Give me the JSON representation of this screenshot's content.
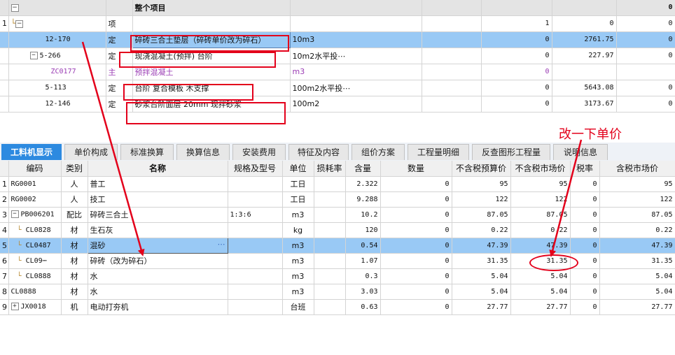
{
  "top_table": {
    "rows": [
      {
        "idx": "",
        "code": "",
        "type": "",
        "name": "整个项目",
        "unit": "",
        "c1": "",
        "c2": "",
        "c3": "0"
      },
      {
        "idx": "1",
        "code": "",
        "type": "项",
        "name": "",
        "unit": "",
        "c1": "1",
        "c2": "0",
        "c3": "0"
      },
      {
        "idx": "",
        "code": "12-170",
        "type": "定",
        "name": "碎砖三合土垫层（碎砖单价改为碎石）",
        "unit": "10m3",
        "c1": "0",
        "c2": "2761.75",
        "c3": "0"
      },
      {
        "idx": "",
        "code": "5-266",
        "type": "定",
        "name": "现浇混凝土(预拌) 台阶",
        "unit": "10m2水平投⋯",
        "c1": "0",
        "c2": "227.97",
        "c3": "0"
      },
      {
        "idx": "",
        "code": "ZC0177",
        "type": "主",
        "name": "预拌混凝土",
        "unit": "m3",
        "c1": "0",
        "c2": "",
        "c3": ""
      },
      {
        "idx": "",
        "code": "5-113",
        "type": "定",
        "name": "台阶 复合模板 木支撑",
        "unit": "100m2水平投⋯",
        "c1": "0",
        "c2": "5643.08",
        "c3": "0"
      },
      {
        "idx": "",
        "code": "12-146",
        "type": "定",
        "name": "砂浆台阶面层 20mm 现拌砂浆",
        "unit": "100m2",
        "c1": "0",
        "c2": "3173.67",
        "c3": "0"
      }
    ]
  },
  "tabs": [
    "工料机显示",
    "单价构成",
    "标准换算",
    "换算信息",
    "安装费用",
    "特征及内容",
    "组价方案",
    "工程量明细",
    "反查图形工程量",
    "说明信息"
  ],
  "annotation": "改一下单价",
  "bottom_table": {
    "headers": [
      "",
      "编码",
      "类别",
      "名称",
      "规格及型号",
      "单位",
      "损耗率",
      "含量",
      "数量",
      "不含税预算价",
      "不含税市场价",
      "税率",
      "含税市场价"
    ],
    "rows": [
      {
        "idx": "1",
        "code": "RG0001",
        "cat": "人",
        "name": "普工",
        "spec": "",
        "unit": "工日",
        "loss": "",
        "qty": "2.322",
        "amount": "0",
        "budget": "95",
        "market": "95",
        "tax": "0",
        "taxed": "95"
      },
      {
        "idx": "2",
        "code": "RG0002",
        "cat": "人",
        "name": "技工",
        "spec": "",
        "unit": "工日",
        "loss": "",
        "qty": "9.288",
        "amount": "0",
        "budget": "122",
        "market": "122",
        "tax": "0",
        "taxed": "122"
      },
      {
        "idx": "3",
        "code": "PB006201",
        "cat": "配比",
        "name": "碎砖三合土",
        "spec": "1:3:6",
        "unit": "m3",
        "loss": "",
        "qty": "10.2",
        "amount": "0",
        "budget": "87.05",
        "market": "87.05",
        "tax": "0",
        "taxed": "87.05"
      },
      {
        "idx": "4",
        "code": "CL0828",
        "cat": "材",
        "name": "生石灰",
        "spec": "",
        "unit": "kg",
        "loss": "",
        "qty": "120",
        "amount": "0",
        "budget": "0.22",
        "market": "0.22",
        "tax": "0",
        "taxed": "0.22"
      },
      {
        "idx": "5",
        "code": "CL0487",
        "cat": "材",
        "name": "混砂",
        "spec": "",
        "unit": "m3",
        "loss": "",
        "qty": "0.54",
        "amount": "0",
        "budget": "47.39",
        "market": "47.39",
        "tax": "0",
        "taxed": "47.39"
      },
      {
        "idx": "6",
        "code": "CL09⋯",
        "cat": "材",
        "name": "碎砖（改为碎石）",
        "spec": "",
        "unit": "m3",
        "loss": "",
        "qty": "1.07",
        "amount": "0",
        "budget": "31.35",
        "market": "31.35",
        "tax": "0",
        "taxed": "31.35"
      },
      {
        "idx": "7",
        "code": "CL0888",
        "cat": "材",
        "name": "水",
        "spec": "",
        "unit": "m3",
        "loss": "",
        "qty": "0.3",
        "amount": "0",
        "budget": "5.04",
        "market": "5.04",
        "tax": "0",
        "taxed": "5.04"
      },
      {
        "idx": "8",
        "code": "CL0888",
        "cat": "材",
        "name": "水",
        "spec": "",
        "unit": "m3",
        "loss": "",
        "qty": "3.03",
        "amount": "0",
        "budget": "5.04",
        "market": "5.04",
        "tax": "0",
        "taxed": "5.04"
      },
      {
        "idx": "9",
        "code": "JX0018",
        "cat": "机",
        "name": "电动打夯机",
        "spec": "",
        "unit": "台班",
        "loss": "",
        "qty": "0.63",
        "amount": "0",
        "budget": "27.77",
        "market": "27.77",
        "tax": "0",
        "taxed": "27.77"
      }
    ]
  },
  "colors": {
    "selected_row": "#99c9f5",
    "active_tab": "#2d8ae0",
    "annotation": "#e3001b"
  }
}
